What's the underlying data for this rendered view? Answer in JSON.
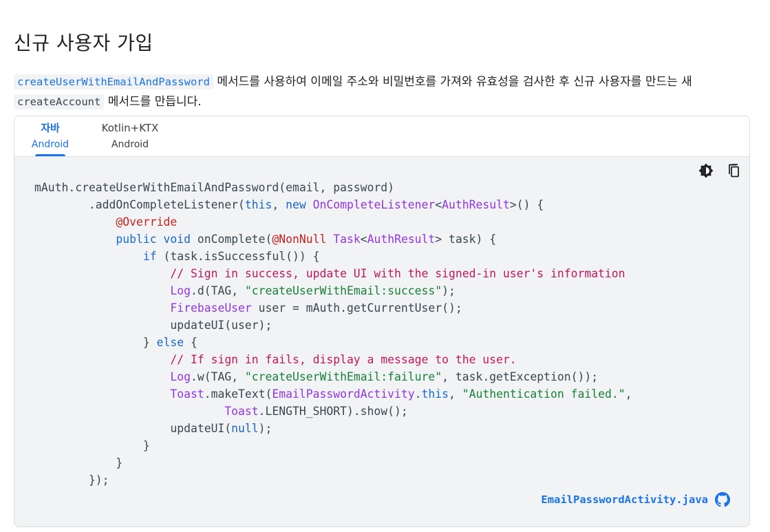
{
  "page": {
    "title": "신규 사용자 가입"
  },
  "intro": {
    "method_link": "createUserWithEmailAndPassword",
    "text_part1": " 메서드를 사용하여 이메일 주소와 비밀번호를 가져와 유효성을 검사한 후 신규 사용자를 만드는 새 ",
    "method_code": "createAccount",
    "text_part2": " 메서드를 만듭니다."
  },
  "tabs": [
    {
      "name": "자바",
      "sub": "Android",
      "active": true
    },
    {
      "name": "Kotlin+KTX",
      "sub": "Android",
      "active": false
    }
  ],
  "tools": {
    "theme_icon": "brightness-icon",
    "copy_icon": "copy-icon"
  },
  "code": {
    "language": "java",
    "lines": [
      "mAuth.createUserWithEmailAndPassword(email, password)",
      "        .addOnCompleteListener(this, new OnCompleteListener<AuthResult>() {",
      "            @Override",
      "            public void onComplete(@NonNull Task<AuthResult> task) {",
      "                if (task.isSuccessful()) {",
      "                    // Sign in success, update UI with the signed-in user's information",
      "                    Log.d(TAG, \"createUserWithEmail:success\");",
      "                    FirebaseUser user = mAuth.getCurrentUser();",
      "                    updateUI(user);",
      "                } else {",
      "                    // If sign in fails, display a message to the user.",
      "                    Log.w(TAG, \"createUserWithEmail:failure\", task.getException());",
      "                    Toast.makeText(EmailPasswordActivity.this, \"Authentication failed.\",",
      "                            Toast.LENGTH_SHORT).show();",
      "                    updateUI(null);",
      "                }",
      "            }",
      "        });"
    ]
  },
  "source": {
    "file": "EmailPasswordActivity.java",
    "icon": "github-icon"
  },
  "colors": {
    "accent": "#1a73e8",
    "keyword": "#1967d2",
    "type": "#9334e6",
    "annotation": "#c5221f",
    "string": "#188038",
    "comment": "#c2185b",
    "code_bg": "#f1f3f4"
  }
}
